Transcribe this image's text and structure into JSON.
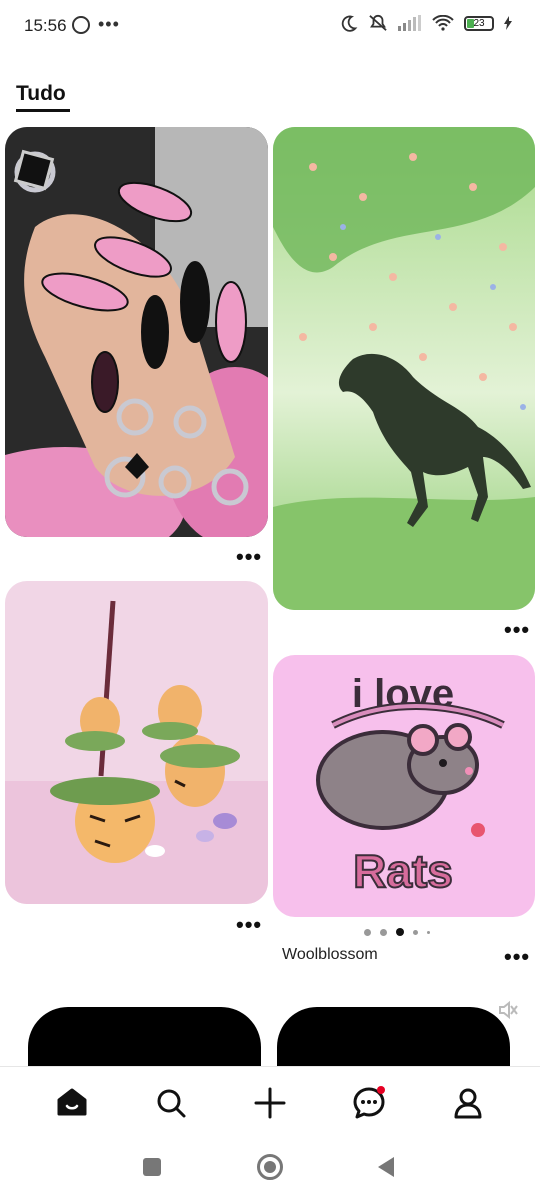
{
  "status_bar": {
    "time": "15:56",
    "battery": "23"
  },
  "tabs": [
    {
      "label": "Tudo",
      "selected": true
    }
  ],
  "feed": {
    "pin5_title": "Woolblossom",
    "pin5_art_line1": "i love",
    "pin5_art_line2": "Rats",
    "carousel": {
      "count": 5,
      "active_index": 2
    }
  },
  "bottom_nav": {
    "items": [
      {
        "name": "home",
        "icon": "home-icon",
        "active": true
      },
      {
        "name": "search",
        "icon": "search-icon"
      },
      {
        "name": "create",
        "icon": "plus-icon"
      },
      {
        "name": "messages",
        "icon": "chat-icon",
        "has_notification": true
      },
      {
        "name": "profile",
        "icon": "profile-icon"
      }
    ]
  }
}
